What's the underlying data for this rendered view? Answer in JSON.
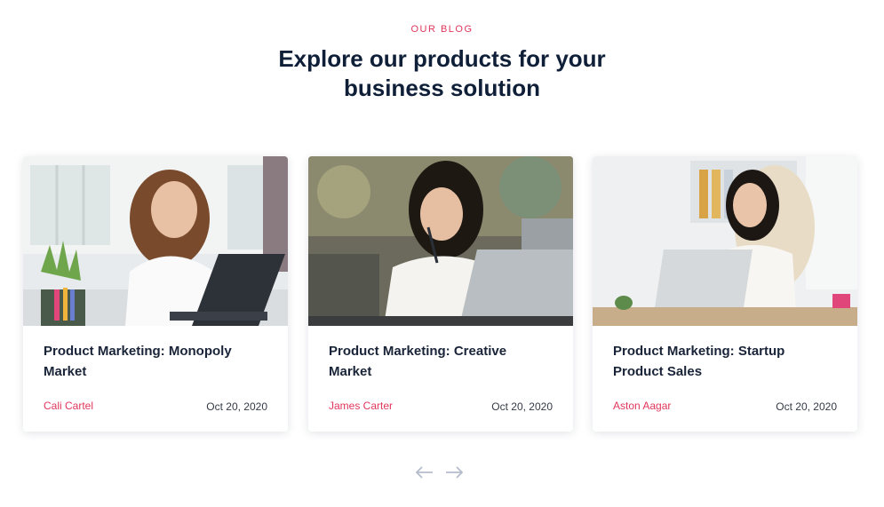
{
  "section": {
    "eyebrow": "OUR BLOG",
    "headline": "Explore our products for your business solution"
  },
  "posts": [
    {
      "title": "Product Marketing: Monopoly Market",
      "author": "Cali Cartel",
      "date": "Oct 20, 2020",
      "image": "woman-smiling-at-laptop-photo"
    },
    {
      "title": "Product Marketing: Creative Market",
      "author": "James Carter",
      "date": "Oct 20, 2020",
      "image": "woman-with-pen-at-laptop-photo"
    },
    {
      "title": "Product Marketing: Startup Product Sales",
      "author": "Aston Aagar",
      "date": "Oct 20, 2020",
      "image": "woman-typing-at-laptop-photo"
    }
  ],
  "carousel": {
    "prev_icon": "arrow-left-icon",
    "next_icon": "arrow-right-icon"
  },
  "colors": {
    "accent": "#e0365b",
    "heading": "#0f1f38",
    "arrow": "#b4bccb"
  }
}
